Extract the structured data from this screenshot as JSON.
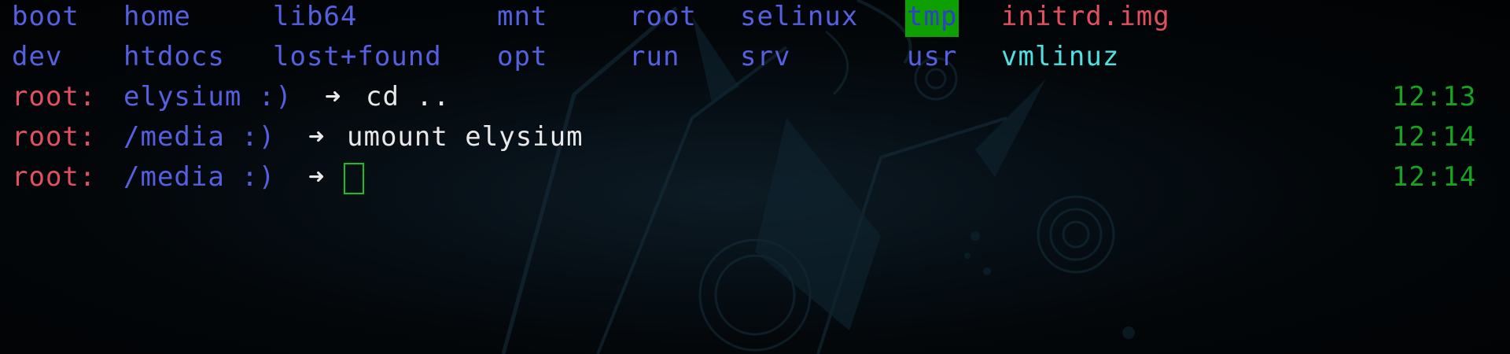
{
  "listing": {
    "row1": [
      "boot",
      "home",
      "lib64",
      "mnt",
      "root",
      "selinux",
      "tmp",
      "initrd.img"
    ],
    "row2": [
      "dev",
      "htdocs",
      "lost+found",
      "opt",
      "run",
      "srv",
      "usr",
      "vmlinuz"
    ]
  },
  "prompt": {
    "user": "root:",
    "arrow": "➜"
  },
  "history": [
    {
      "path": "elysium :)",
      "command": "cd ..",
      "time": "12:13"
    },
    {
      "path": "/media :)",
      "command": "umount elysium",
      "time": "12:14"
    },
    {
      "path": "/media :)",
      "command": "",
      "time": "12:14"
    }
  ],
  "colors": {
    "directory": "#5560e0",
    "symlink_file": "#e05060",
    "executable": "#50e0e0",
    "highlight_bg": "#0da000",
    "time": "#17a321",
    "prompt_user": "#e05060",
    "command_text": "#e8e8e8"
  }
}
